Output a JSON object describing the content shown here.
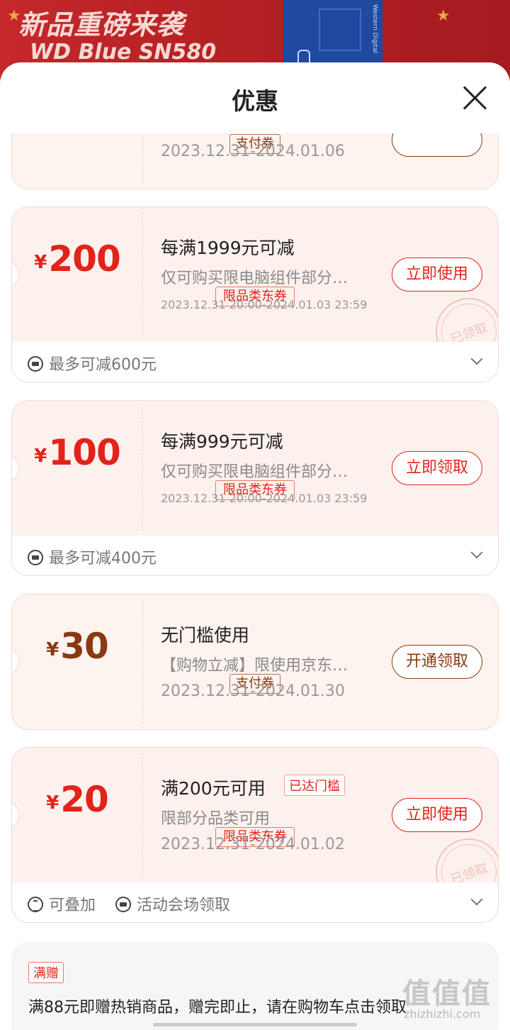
{
  "banner": {
    "line1": "新品重磅来袭",
    "line2": "WD Blue SN580",
    "box_label": "Western Digital"
  },
  "sheet": {
    "title": "优惠"
  },
  "cards": [
    {
      "currency": "¥",
      "amount": "",
      "tag": "支付券",
      "title": "",
      "desc": "",
      "date": "2023.12.31-2024.01.06",
      "button": ""
    },
    {
      "currency": "¥",
      "amount": "200",
      "tag": "限品类东券",
      "title": "每满1999元可减",
      "desc": "仅可购买限电脑组件部分…",
      "date": "2023.12.31 20:00-2024.01.03 23:59",
      "button": "立即使用",
      "stamp": "已领取",
      "footer": [
        "最多可减600元"
      ]
    },
    {
      "currency": "¥",
      "amount": "100",
      "tag": "限品类东券",
      "title": "每满999元可减",
      "desc": "仅可购买限电脑组件部分…",
      "date": "2023.12.31 20:00-2024.01.03 23:59",
      "button": "立即领取",
      "footer": [
        "最多可减400元"
      ]
    },
    {
      "currency": "¥",
      "amount": "30",
      "tag": "支付券",
      "title": "无门槛使用",
      "desc": "【购物立减】限使用京东…",
      "date": "2023.12.31-2024.01.30",
      "button": "开通领取"
    },
    {
      "currency": "¥",
      "amount": "20",
      "tag": "限品类东券",
      "title": "满200元可用",
      "badge": "已达门槛",
      "desc": "限部分品类可用",
      "date": "2023.12.31-2024.01.02",
      "button": "立即使用",
      "stamp": "已领取",
      "footer": [
        "可叠加",
        "活动会场领取"
      ]
    }
  ],
  "gift": {
    "tag": "满赠",
    "text": "满88元即赠热销商品，赠完即止，请在购物车点击领取"
  },
  "watermark": {
    "big": "值值值",
    "small": "zhizhizhi.com"
  }
}
